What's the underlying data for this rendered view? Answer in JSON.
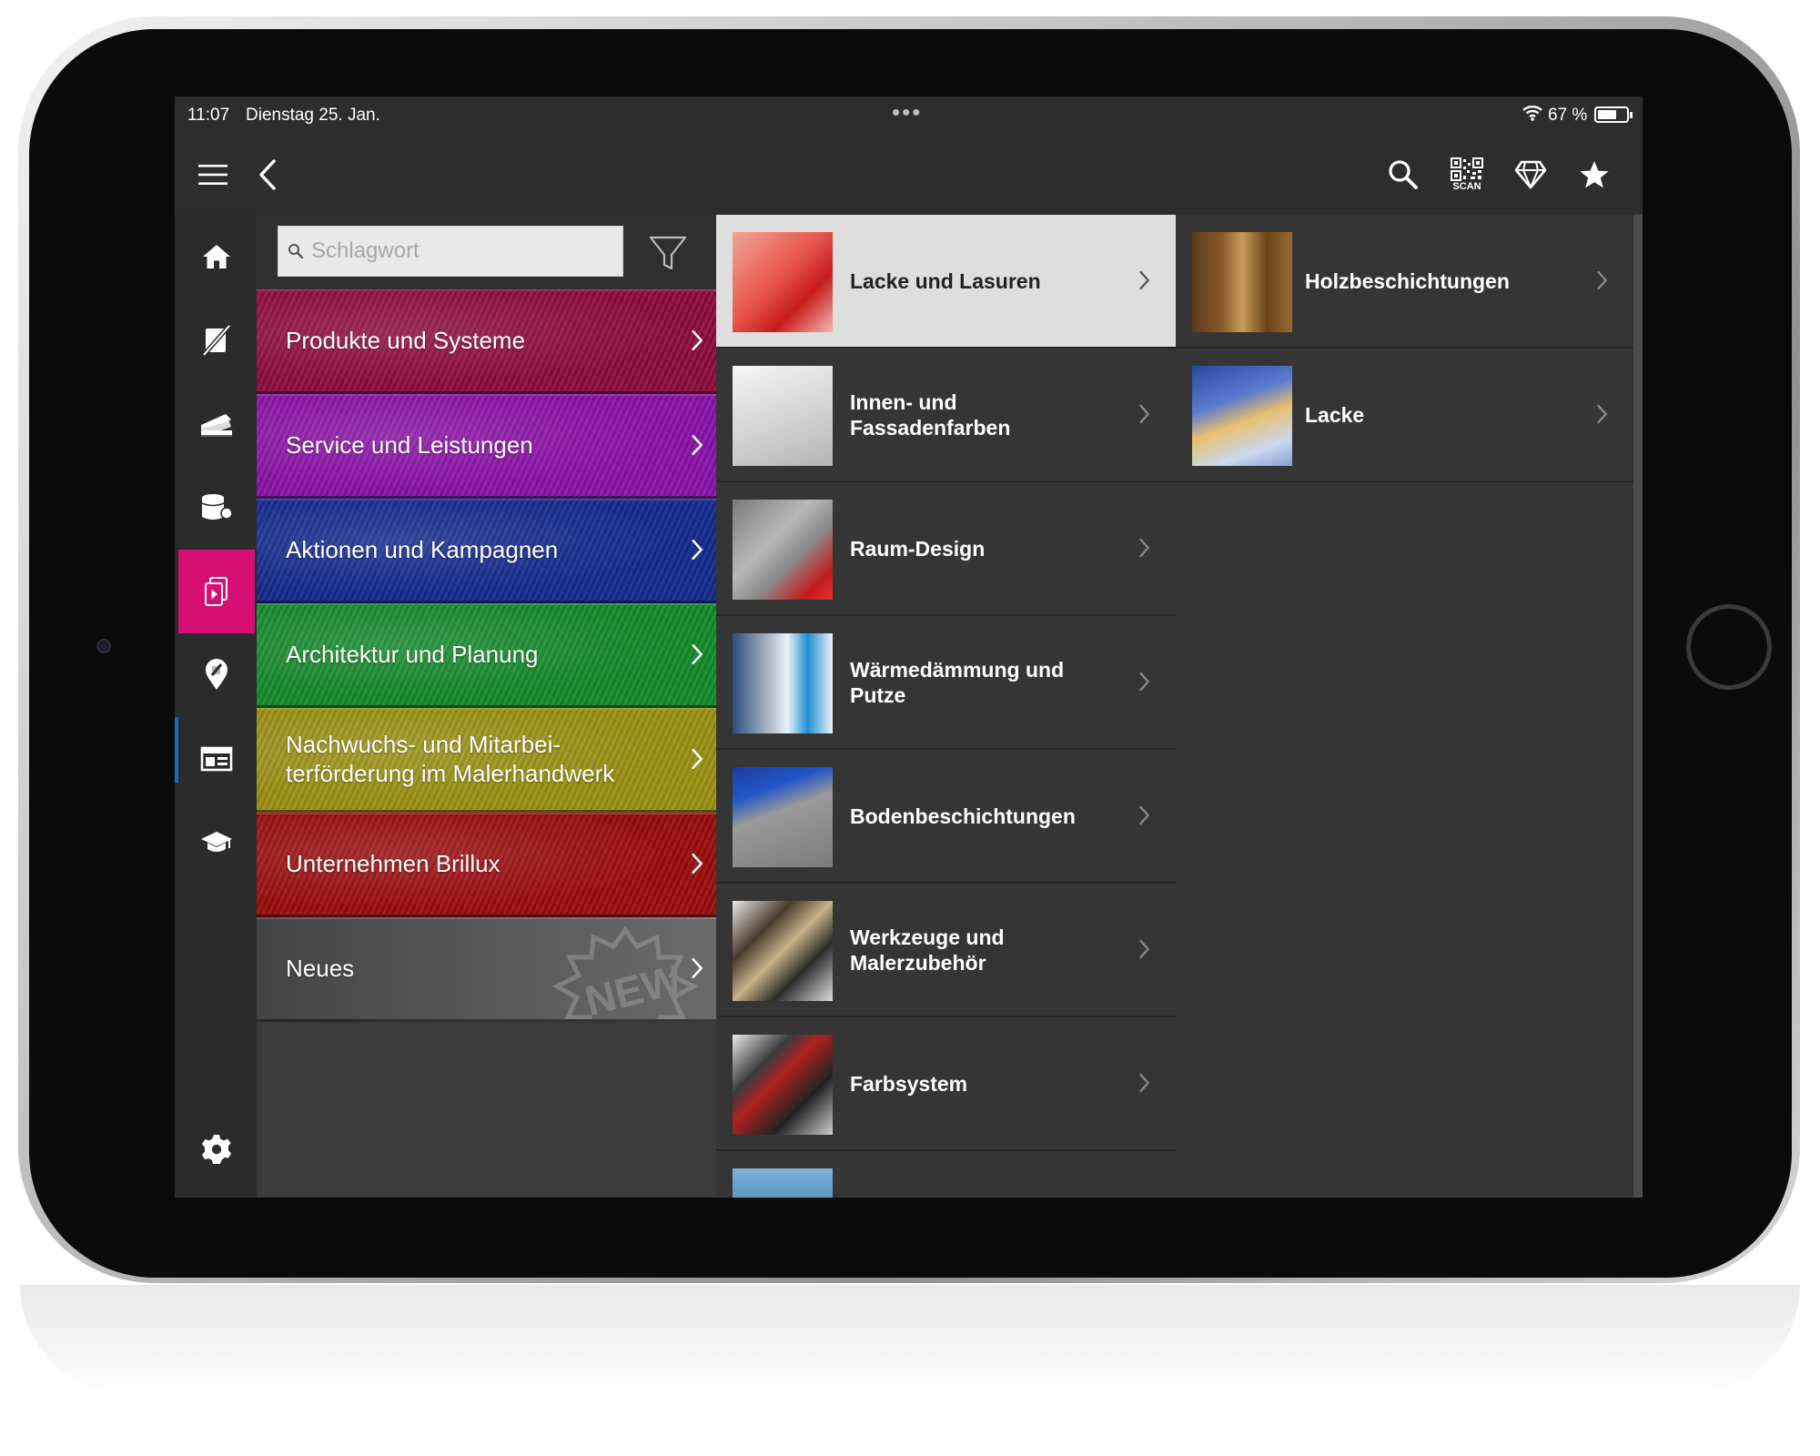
{
  "status": {
    "time": "11:07",
    "date": "Dienstag 25. Jan.",
    "battery_text": "67 %",
    "battery_level": 0.67
  },
  "toolbar": {
    "menu_icon": "hamburger-menu-icon",
    "back_icon": "chevron-left-icon",
    "search_icon": "search-icon",
    "scan_label": "SCAN",
    "diamond_icon": "diamond-icon",
    "favorites_icon": "star-icon"
  },
  "sidebar": {
    "items": [
      {
        "icon": "home-icon"
      },
      {
        "icon": "no-paint-icon"
      },
      {
        "icon": "color-fan-icon"
      },
      {
        "icon": "paint-bucket-icon"
      },
      {
        "icon": "media-document-icon",
        "active": true
      },
      {
        "icon": "location-pin-icon"
      },
      {
        "icon": "catalog-layout-icon"
      },
      {
        "icon": "graduation-cap-icon"
      }
    ],
    "settings_icon": "gear-icon",
    "active_color": "#d50f73"
  },
  "search": {
    "placeholder": "Schlagwort",
    "value": ""
  },
  "categories": [
    {
      "label": "Produkte und Systeme",
      "color": "#8e0e3e"
    },
    {
      "label": "Service und Leistungen",
      "color": "#8a14a6"
    },
    {
      "label": "Aktionen und Kampagnen",
      "color": "#152c8e"
    },
    {
      "label": "Architektur und Planung",
      "color": "#168a2c"
    },
    {
      "label": "Nachwuchs- und Mitarbei­terförderung im Malerhand­werk",
      "color": "#9a9014"
    },
    {
      "label": "Unternehmen Brillux",
      "color": "#9a1010"
    },
    {
      "label": "Neues",
      "badge": "NEW"
    }
  ],
  "subcategories": [
    {
      "label": "Lacke und Lasuren",
      "selected": true
    },
    {
      "label": "Innen- und Fassadenfarben"
    },
    {
      "label": "Raum-Design"
    },
    {
      "label": "Wärmedämmung und Putze"
    },
    {
      "label": "Bodenbeschichtungen"
    },
    {
      "label": "Werkzeuge und Malerzubehör"
    },
    {
      "label": "Farbsystem"
    }
  ],
  "products": [
    {
      "label": "Holzbeschichtungen"
    },
    {
      "label": "Lacke"
    }
  ]
}
